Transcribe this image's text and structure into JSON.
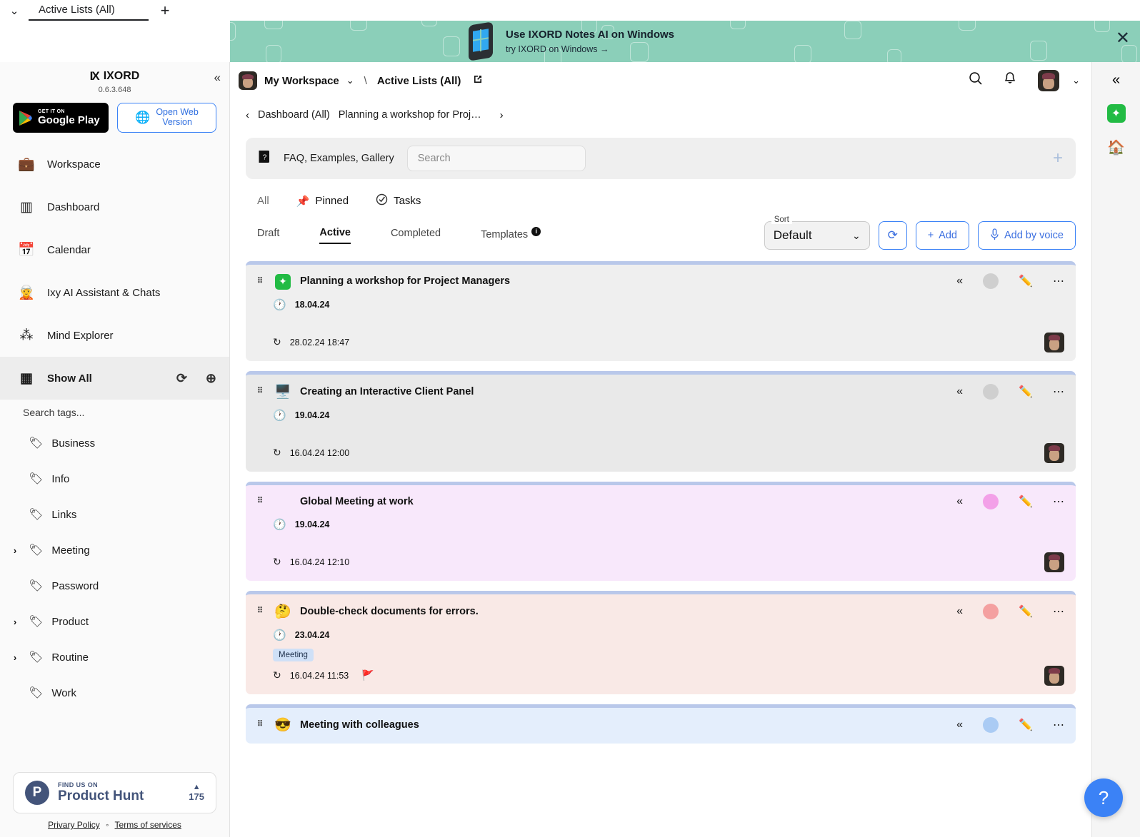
{
  "browser_tabs": {
    "chevron_icon": "chevron-down",
    "active_tab_label": "Active Lists (All)",
    "new_tab_label": "+"
  },
  "banner": {
    "title": "Use IXORD Notes AI on Windows",
    "subtitle": "try IXORD on Windows →",
    "close_label": "✕",
    "bg_color": "#8bcfb9"
  },
  "sidebar": {
    "brand_mark": "IX",
    "brand_name": "IXORD",
    "version": "0.6.3.648",
    "collapse_label": "«",
    "google_play": {
      "small": "GET IT ON",
      "big": "Google Play"
    },
    "open_web": {
      "line1": "Open Web",
      "line2": "Version"
    },
    "nav": [
      {
        "icon": "briefcase-icon",
        "glyph": "💼",
        "label": "Workspace",
        "active": false
      },
      {
        "icon": "dashboard-icon",
        "glyph": "▥",
        "label": "Dashboard",
        "active": false
      },
      {
        "icon": "calendar-icon",
        "glyph": "📅",
        "label": "Calendar",
        "active": false
      },
      {
        "icon": "assistant-avatar-icon",
        "glyph": "🧝",
        "label": "Ixy AI Assistant & Chats",
        "active": false
      },
      {
        "icon": "mind-explorer-icon",
        "glyph": "⁂",
        "label": "Mind Explorer",
        "active": false
      },
      {
        "icon": "grid-icon",
        "glyph": "▦",
        "label": "Show All",
        "active": true,
        "trail_refresh": "⟳",
        "trail_add": "⊕"
      }
    ],
    "tag_search_placeholder": "Search tags...",
    "tags": [
      {
        "label": "Business",
        "expandable": false
      },
      {
        "label": "Info",
        "expandable": false
      },
      {
        "label": "Links",
        "expandable": false
      },
      {
        "label": "Meeting",
        "expandable": true
      },
      {
        "label": "Password",
        "expandable": false
      },
      {
        "label": "Product",
        "expandable": true
      },
      {
        "label": "Routine",
        "expandable": true
      },
      {
        "label": "Work",
        "expandable": false
      }
    ],
    "product_hunt": {
      "small": "FIND US ON",
      "big": "Product Hunt",
      "triangle": "▲",
      "votes": "175"
    },
    "legal": {
      "privacy": "Privary Policy",
      "separator": "◦",
      "terms": "Terms of services"
    }
  },
  "topbar": {
    "workspace_name": "My Workspace",
    "chevron": "⌄",
    "slash": "\\",
    "current_list": "Active Lists (All)",
    "external_icon": "↗",
    "search_icon": "search-icon",
    "bell_icon": "bell-icon",
    "account_chevron": "⌄",
    "collapse_right": "«"
  },
  "breadcrumbs": {
    "back": "‹",
    "forward": "›",
    "items": [
      "Dashboard (All)",
      "Planning a workshop for Proj…"
    ]
  },
  "faqbar": {
    "icon": "help-book-icon",
    "label": "FAQ, Examples, Gallery",
    "search_placeholder": "Search",
    "search_value": "",
    "add_icon": "+"
  },
  "filters": [
    {
      "label": "All",
      "icon": null,
      "selected": false
    },
    {
      "label": "Pinned",
      "icon": "📌",
      "selected": false
    },
    {
      "label": "Tasks",
      "icon": "✓",
      "selected": false
    }
  ],
  "status_tabs": [
    {
      "label": "Draft",
      "selected": false
    },
    {
      "label": "Active",
      "selected": true
    },
    {
      "label": "Completed",
      "selected": false
    },
    {
      "label": "Templates",
      "selected": false,
      "info_badge": "i"
    }
  ],
  "toolbar": {
    "sort_label": "Sort",
    "sort_value": "Default",
    "sort_chevron": "⌄",
    "refresh_icon": "⟳",
    "add_label": "Add",
    "add_icon": "+",
    "add_by_voice_label": "Add by voice",
    "voice_icon": "🎤"
  },
  "cards": [
    {
      "emoji": "✦",
      "emoji_kind": "green-badge",
      "title": "Planning a workshop for Project Managers",
      "date": "18.04.24",
      "updated": "28.02.24 18:47",
      "tag": null,
      "flag": false,
      "bg": "#efefef",
      "accent": "#b9c8ea",
      "dot_color": "#cfcfcf",
      "collapse_icon": "«",
      "edit_icon": "✏",
      "more_icon": "⋯"
    },
    {
      "emoji": "🖥",
      "emoji_kind": "emoji",
      "title": "Creating an Interactive Client Panel",
      "date": "19.04.24",
      "updated": "16.04.24 12:00",
      "tag": null,
      "flag": false,
      "bg": "#e9e9e9",
      "accent": "#b9c8ea",
      "dot_color": "#cfcfcf",
      "collapse_icon": "«",
      "edit_icon": "✏",
      "more_icon": "⋯"
    },
    {
      "emoji": "",
      "emoji_kind": "none",
      "title": "Global Meeting at work",
      "date": "19.04.24",
      "updated": "16.04.24 12:10",
      "tag": null,
      "flag": false,
      "bg": "#f8e8fb",
      "accent": "#b9c8ea",
      "dot_color": "#f3a0e8",
      "collapse_icon": "«",
      "edit_icon": "✏",
      "more_icon": "⋯"
    },
    {
      "emoji": "🤔",
      "emoji_kind": "emoji",
      "title": "Double-check documents for errors.",
      "date": "23.04.24",
      "updated": "16.04.24 11:53",
      "tag": "Meeting",
      "flag": true,
      "flag_icon": "🚩",
      "bg": "#f9e9e6",
      "accent": "#b9c8ea",
      "dot_color": "#f4a0a0",
      "collapse_icon": "«",
      "edit_icon": "✏",
      "more_icon": "⋯"
    },
    {
      "emoji": "😎",
      "emoji_kind": "emoji",
      "title": "Meeting with colleagues",
      "date": "",
      "updated": "",
      "tag": null,
      "flag": false,
      "bg": "#e4eefc",
      "accent": "#b9c8ea",
      "dot_color": "#aacbf4",
      "collapse_icon": "«",
      "edit_icon": "✏",
      "more_icon": "⋯"
    }
  ],
  "right_rail": {
    "collapse_icon": "«",
    "items": [
      {
        "name": "notes-app-icon",
        "glyph": "✦"
      },
      {
        "name": "home-icon",
        "glyph": "🏠"
      }
    ]
  },
  "help_fab": {
    "label": "?",
    "color": "#3b82f6"
  }
}
